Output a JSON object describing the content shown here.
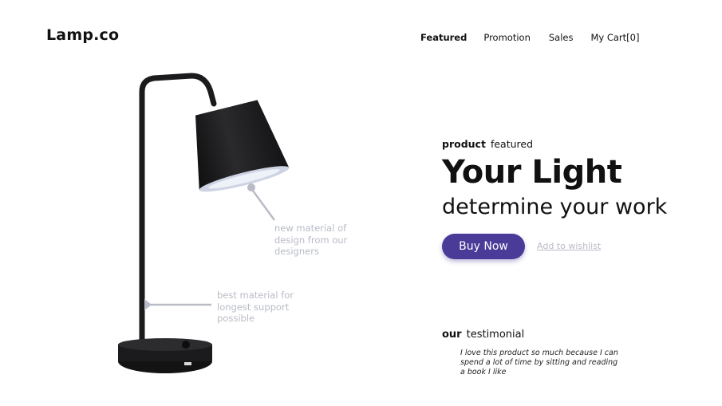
{
  "brand": {
    "logo": "Lamp.co"
  },
  "nav": {
    "featured": "Featured",
    "promotion": "Promotion",
    "sales": "Sales",
    "cart": "My Cart[0]"
  },
  "callouts": {
    "top": "new material of design from our designers",
    "bottom": "best material for longest support possible"
  },
  "hero": {
    "eyebrow_bold": "product",
    "eyebrow_rest": "featured",
    "headline": "Your Light",
    "subhead": "determine your work",
    "buy_label": "Buy Now",
    "wishlist_label": "Add to wishlist"
  },
  "testimonial": {
    "title_bold": "our",
    "title_rest": "testimonial",
    "quote": "I love this product so much because I can spend a lot of time by sitting and reading a book I like"
  },
  "colors": {
    "accent": "#4a3b98",
    "muted": "#b9bcc6",
    "text": "#111111",
    "lamp": "#1b1b1d"
  }
}
